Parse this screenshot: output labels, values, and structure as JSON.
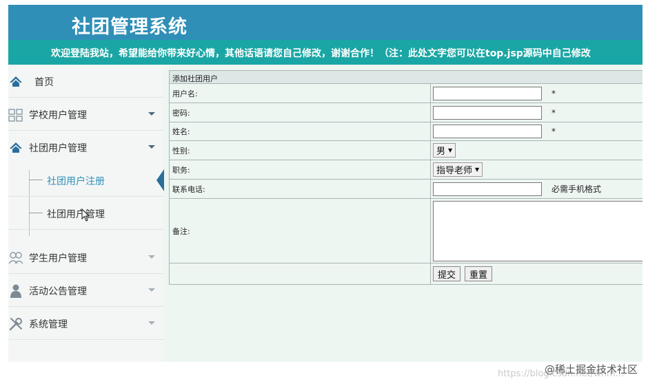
{
  "header": {
    "title": "社团管理系统"
  },
  "marquee": {
    "text": "欢迎登陆我站，希望能给你带来好心情，其他话语请您自己修改，谢谢合作！（注：此处文字您可以在top.jsp源码中自己修改"
  },
  "sidebar": {
    "items": [
      {
        "label": "首页",
        "icon": "home-icon"
      },
      {
        "label": "学校用户管理",
        "icon": "grid-icon"
      },
      {
        "label": "社团用户管理",
        "icon": "home-icon"
      },
      {
        "label": "学生用户管理",
        "icon": "users-icon"
      },
      {
        "label": "活动公告管理",
        "icon": "user-icon"
      },
      {
        "label": "系统管理",
        "icon": "tools-icon"
      }
    ],
    "subitems": [
      {
        "label": "社团用户注册"
      },
      {
        "label": "社团用户管理"
      }
    ]
  },
  "form": {
    "title": "添加社团用户",
    "username_label": "用户名:",
    "password_label": "密码:",
    "name_label": "姓名:",
    "gender_label": "性别:",
    "gender_value": "男",
    "position_label": "职务:",
    "position_value": "指导老师",
    "phone_label": "联系电话:",
    "phone_hint": "必需手机格式",
    "remark_label": "备注:",
    "required_mark": "*",
    "submit_label": "提交",
    "reset_label": "重置"
  },
  "watermark": {
    "logo_text": "@稀土掘金技术社区",
    "url_text": "https://blog.csdn.net/whm..."
  },
  "colors": {
    "header": "#2f8fb7",
    "marquee": "#1aa6a4",
    "sidebar": "#f4f6f6",
    "content_bg": "#eef6f2",
    "active_text": "#2f8fb7"
  }
}
